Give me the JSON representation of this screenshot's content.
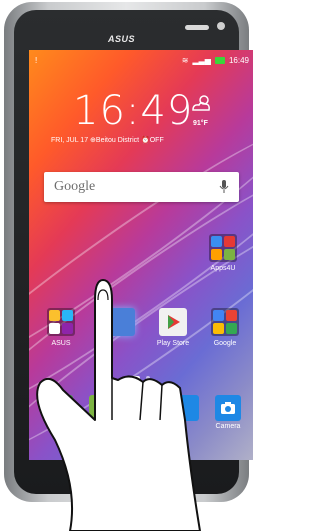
{
  "device": {
    "logo": "ASUS"
  },
  "status": {
    "time": "16:49"
  },
  "clock": {
    "time": "16:49"
  },
  "weather": {
    "temp": "91°F"
  },
  "info": {
    "line": "FRI, JUL 17  ⊕Beitou District  ⏰OFF"
  },
  "search": {
    "label": "Google"
  },
  "folders": {
    "apps4u": "Apps4U",
    "asus": "ASUS",
    "google": "Google"
  },
  "apps": {
    "play_store": "Play Store"
  },
  "dock": {
    "phone": "Phone",
    "camera": "Camera"
  },
  "colors": {
    "accent": "#1e88e5"
  }
}
